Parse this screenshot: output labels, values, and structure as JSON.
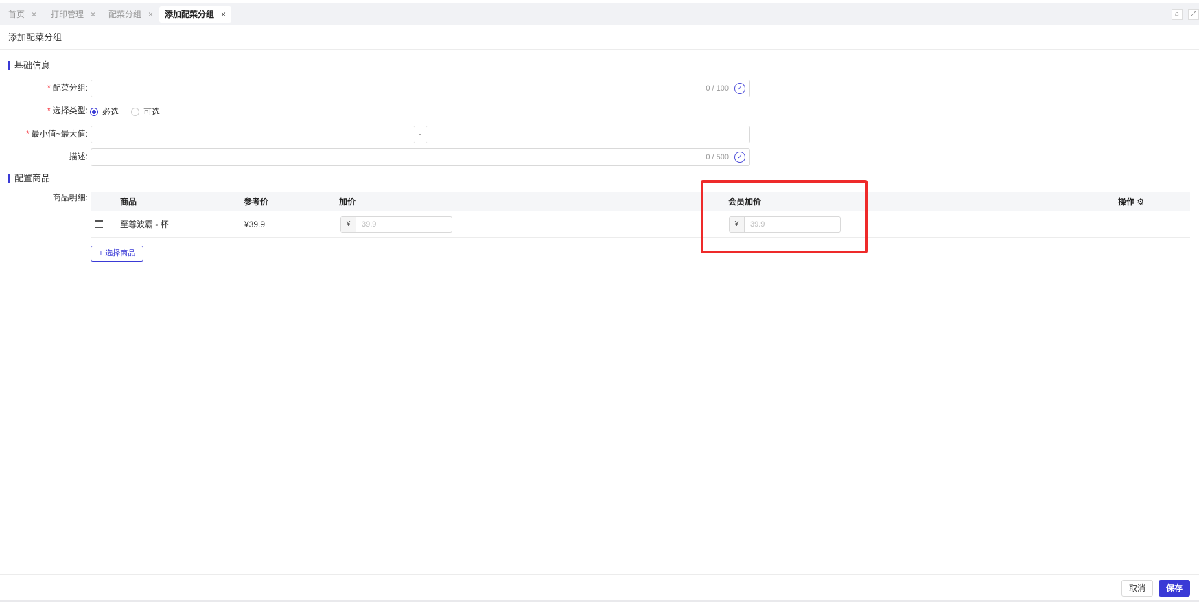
{
  "tabs": [
    {
      "label": "首页",
      "active": false
    },
    {
      "label": "打印管理",
      "active": false
    },
    {
      "label": "配菜分组",
      "active": false
    },
    {
      "label": "添加配菜分组",
      "active": true
    }
  ],
  "tab_close_glyph": "×",
  "page_title": "添加配菜分组",
  "sections": {
    "basic": "基础信息",
    "goods": "配置商品"
  },
  "form": {
    "group_name": {
      "label": "配菜分组:",
      "counter": "0 / 100",
      "required": true
    },
    "select_type": {
      "label": "选择类型:",
      "required": true,
      "options": [
        {
          "label": "必选",
          "checked": true
        },
        {
          "label": "可选",
          "checked": false
        }
      ]
    },
    "min_max": {
      "label": "最小值~最大值:",
      "separator": "-",
      "required": true
    },
    "description": {
      "label": "描述:",
      "counter": "0 / 500",
      "required": false
    }
  },
  "goods_table": {
    "label": "商品明细:",
    "columns": [
      "商品",
      "参考价",
      "加价",
      "会员加价",
      "操作"
    ],
    "rows": [
      {
        "name": "至尊波霸 - 杯",
        "ref_price": "¥39.9",
        "add_price_prefix": "¥",
        "add_price_placeholder": "39.9",
        "member_price_prefix": "¥",
        "member_price_placeholder": "39.9"
      }
    ],
    "add_button": "+ 选择商品"
  },
  "footer": {
    "cancel": "取消",
    "save": "保存"
  },
  "colors": {
    "accent": "#3a3ad6",
    "highlight": "#ee2a2a",
    "required": "#f5222d"
  }
}
